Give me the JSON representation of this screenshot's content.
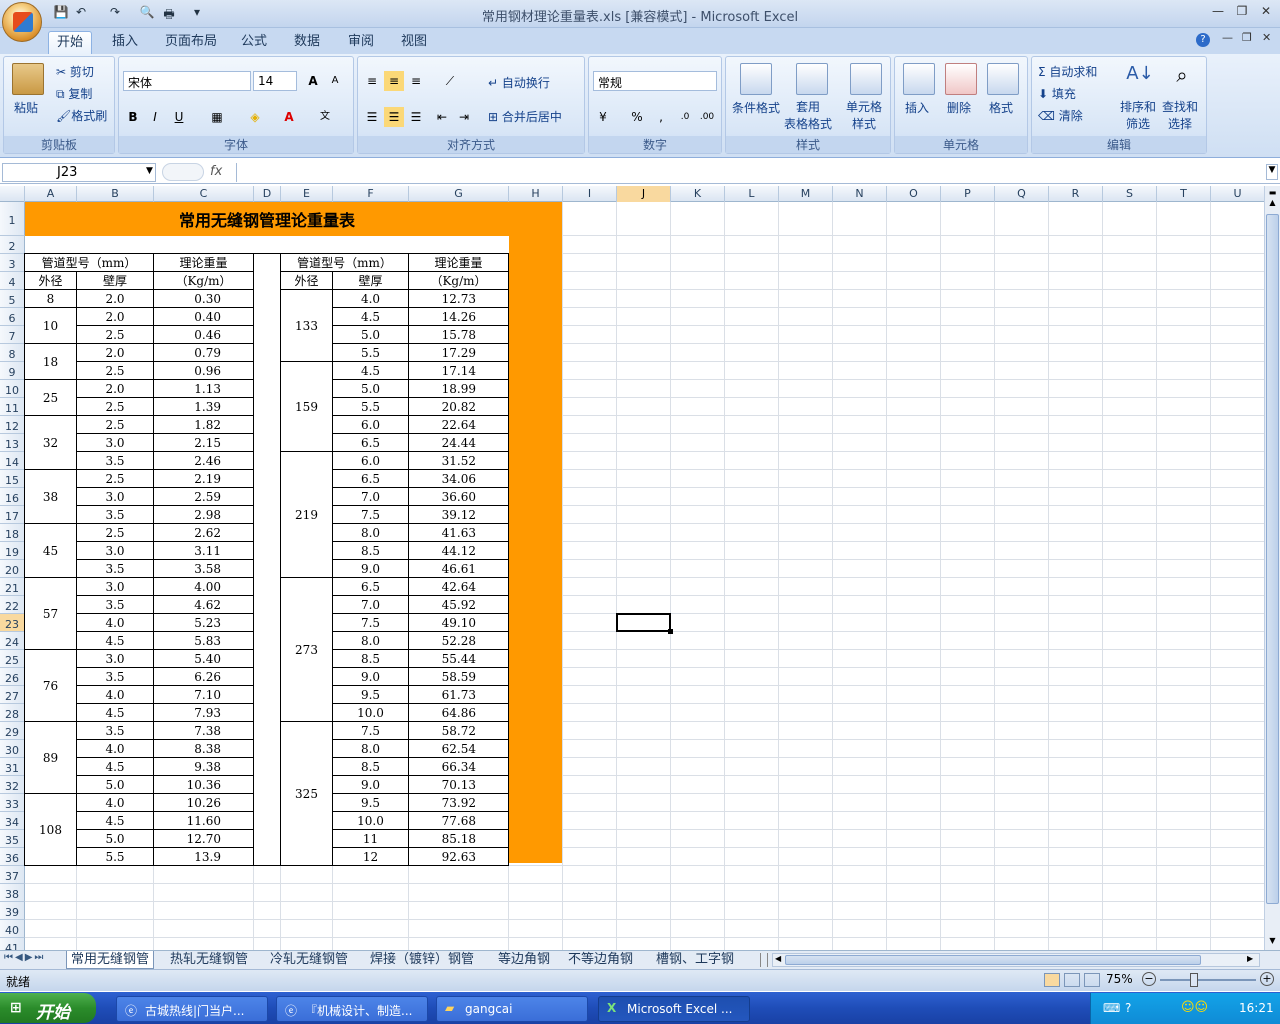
{
  "window": {
    "title": "常用钢材理论重量表.xls  [兼容模式] - Microsoft Excel"
  },
  "qat": {
    "more": "▾"
  },
  "ribbon_tabs": [
    "开始",
    "插入",
    "页面布局",
    "公式",
    "数据",
    "审阅",
    "视图"
  ],
  "ribbon": {
    "clipboard": {
      "paste": "粘贴",
      "cut": "剪切",
      "copy": "复制",
      "painter": "格式刷",
      "label": "剪贴板"
    },
    "font": {
      "name": "宋体",
      "size": "14",
      "bold": "B",
      "italic": "I",
      "underline": "U",
      "label": "字体",
      "grow": "A",
      "shrink": "A"
    },
    "align": {
      "wrap": "自动换行",
      "merge": "合并后居中",
      "label": "对齐方式"
    },
    "number": {
      "format": "常规",
      "percent": "%",
      "comma": ",",
      "label": "数字"
    },
    "styles": {
      "cond": "条件格式",
      "table": "套用\n表格格式",
      "cellstyle": "单元格\n样式",
      "label": "样式"
    },
    "cells": {
      "insert": "插入",
      "delete": "删除",
      "format": "格式",
      "label": "单元格"
    },
    "edit": {
      "autosum": "自动求和",
      "fill": "填充",
      "clear": "清除",
      "sort": "排序和\n筛选",
      "find": "查找和\n选择",
      "label": "编辑"
    }
  },
  "formula": {
    "namebox": "J23",
    "fx": "fx",
    "content": ""
  },
  "columns": [
    "A",
    "B",
    "C",
    "D",
    "E",
    "F",
    "G",
    "H",
    "I",
    "J",
    "K",
    "L",
    "M",
    "N",
    "O",
    "P",
    "Q",
    "R",
    "S",
    "T",
    "U"
  ],
  "selected_cell": "J23",
  "sheet": {
    "title": "常用无缝钢管理论重量表",
    "hdr_type": "管道型号（mm）",
    "hdr_weight": "理论重量",
    "hdr_unit": "（Kg/m）",
    "hdr_od": "外径",
    "hdr_wall": "壁厚",
    "left": [
      {
        "od": "8",
        "rows": [
          [
            "2.0",
            "0.30"
          ]
        ]
      },
      {
        "od": "10",
        "rows": [
          [
            "2.0",
            "0.40"
          ],
          [
            "2.5",
            "0.46"
          ]
        ]
      },
      {
        "od": "18",
        "rows": [
          [
            "2.0",
            "0.79"
          ],
          [
            "2.5",
            "0.96"
          ]
        ]
      },
      {
        "od": "25",
        "rows": [
          [
            "2.0",
            "1.13"
          ],
          [
            "2.5",
            "1.39"
          ]
        ]
      },
      {
        "od": "32",
        "rows": [
          [
            "2.5",
            "1.82"
          ],
          [
            "3.0",
            "2.15"
          ],
          [
            "3.5",
            "2.46"
          ]
        ]
      },
      {
        "od": "38",
        "rows": [
          [
            "2.5",
            "2.19"
          ],
          [
            "3.0",
            "2.59"
          ],
          [
            "3.5",
            "2.98"
          ]
        ]
      },
      {
        "od": "45",
        "rows": [
          [
            "2.5",
            "2.62"
          ],
          [
            "3.0",
            "3.11"
          ],
          [
            "3.5",
            "3.58"
          ]
        ]
      },
      {
        "od": "57",
        "rows": [
          [
            "3.0",
            "4.00"
          ],
          [
            "3.5",
            "4.62"
          ],
          [
            "4.0",
            "5.23"
          ],
          [
            "4.5",
            "5.83"
          ]
        ]
      },
      {
        "od": "76",
        "rows": [
          [
            "3.0",
            "5.40"
          ],
          [
            "3.5",
            "6.26"
          ],
          [
            "4.0",
            "7.10"
          ],
          [
            "4.5",
            "7.93"
          ]
        ]
      },
      {
        "od": "89",
        "rows": [
          [
            "3.5",
            "7.38"
          ],
          [
            "4.0",
            "8.38"
          ],
          [
            "4.5",
            "9.38"
          ],
          [
            "5.0",
            "10.36"
          ]
        ]
      },
      {
        "od": "108",
        "rows": [
          [
            "4.0",
            "10.26"
          ],
          [
            "4.5",
            "11.60"
          ],
          [
            "5.0",
            "12.70"
          ],
          [
            "5.5",
            "13.9"
          ]
        ]
      }
    ],
    "right": [
      {
        "od": "133",
        "rows": [
          [
            "4.0",
            "12.73"
          ],
          [
            "4.5",
            "14.26"
          ],
          [
            "5.0",
            "15.78"
          ],
          [
            "5.5",
            "17.29"
          ]
        ]
      },
      {
        "od": "159",
        "rows": [
          [
            "4.5",
            "17.14"
          ],
          [
            "5.0",
            "18.99"
          ],
          [
            "5.5",
            "20.82"
          ],
          [
            "6.0",
            "22.64"
          ],
          [
            "6.5",
            "24.44"
          ]
        ]
      },
      {
        "od": "219",
        "rows": [
          [
            "6.0",
            "31.52"
          ],
          [
            "6.5",
            "34.06"
          ],
          [
            "7.0",
            "36.60"
          ],
          [
            "7.5",
            "39.12"
          ],
          [
            "8.0",
            "41.63"
          ],
          [
            "8.5",
            "44.12"
          ],
          [
            "9.0",
            "46.61"
          ]
        ]
      },
      {
        "od": "273",
        "rows": [
          [
            "6.5",
            "42.64"
          ],
          [
            "7.0",
            "45.92"
          ],
          [
            "7.5",
            "49.10"
          ],
          [
            "8.0",
            "52.28"
          ],
          [
            "8.5",
            "55.44"
          ],
          [
            "9.0",
            "58.59"
          ],
          [
            "9.5",
            "61.73"
          ],
          [
            "10.0",
            "64.86"
          ]
        ]
      },
      {
        "od": "325",
        "rows": [
          [
            "7.5",
            "58.72"
          ],
          [
            "8.0",
            "62.54"
          ],
          [
            "8.5",
            "66.34"
          ],
          [
            "9.0",
            "70.13"
          ],
          [
            "9.5",
            "73.92"
          ],
          [
            "10.0",
            "77.68"
          ],
          [
            "11",
            "85.18"
          ],
          [
            "12",
            "92.63"
          ]
        ]
      }
    ]
  },
  "sheet_tabs": [
    "常用无缝钢管",
    "热轧无缝钢管",
    "冷轧无缝钢管",
    "焊接（镀锌）钢管",
    "等边角钢",
    "不等边角钢",
    "槽钢、工字钢"
  ],
  "status": {
    "ready": "就绪",
    "zoom": "75%"
  },
  "taskbar": {
    "start": "开始",
    "items": [
      "古城热线|门当户...",
      "『机械设计、制造...",
      "gangcai",
      "Microsoft Excel ..."
    ],
    "clock": "16:21"
  },
  "colors": {
    "accent": "#ff9900",
    "selection": "#f9d99f"
  }
}
